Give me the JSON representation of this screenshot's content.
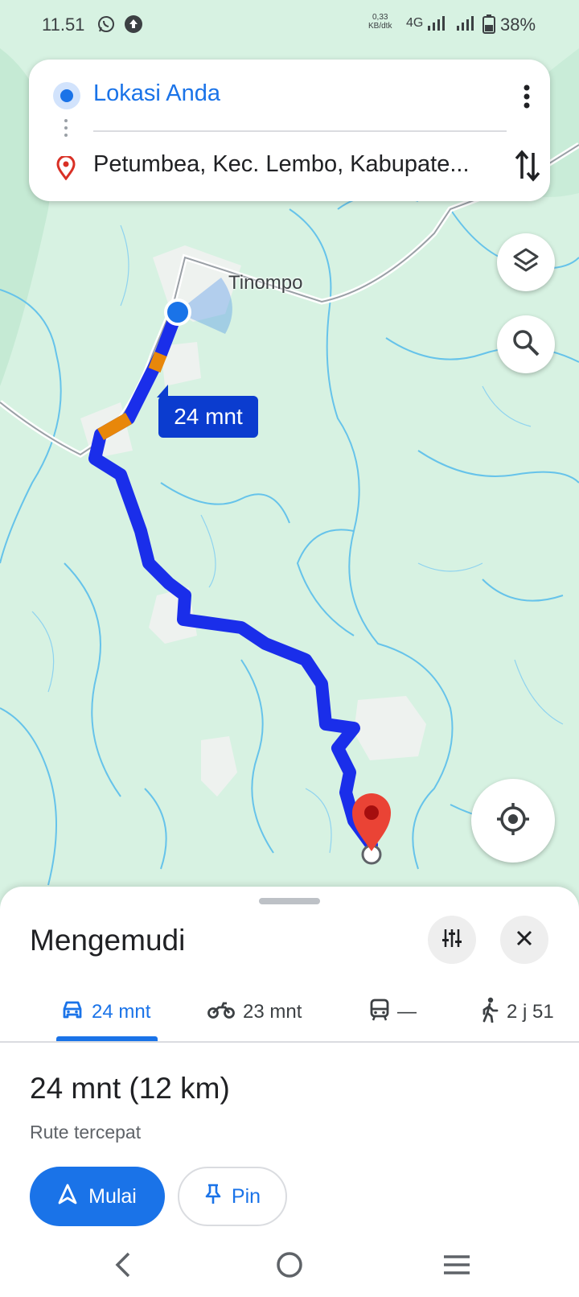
{
  "status_bar": {
    "time": "11.51",
    "net_speed_value": "0,33",
    "net_speed_unit": "KB/dtk",
    "network": "4G",
    "battery": "38%"
  },
  "search": {
    "origin": "Lokasi Anda",
    "destination": "Petumbea, Kec. Lembo, Kabupate..."
  },
  "map": {
    "place_label": "Tinompo",
    "route_duration_badge": "24 mnt",
    "colors": {
      "route": "#1a2eea",
      "traffic": "#e8870a",
      "water": "#5bb8e8",
      "land": "#d7f2e2",
      "destination_pin": "#ea4335"
    }
  },
  "sheet": {
    "title": "Mengemudi",
    "modes": [
      {
        "icon": "car-icon",
        "label": "24 mnt",
        "active": true
      },
      {
        "icon": "motorcycle-icon",
        "label": "23 mnt",
        "active": false
      },
      {
        "icon": "transit-icon",
        "label": "—",
        "active": false
      },
      {
        "icon": "walk-icon",
        "label": "2 j 51",
        "active": false
      }
    ],
    "summary_time": "24 mnt (12 km)",
    "summary_sub": "Rute tercepat",
    "start_label": "Mulai",
    "pin_label": "Pin"
  },
  "accent_color": "#1a73e8"
}
